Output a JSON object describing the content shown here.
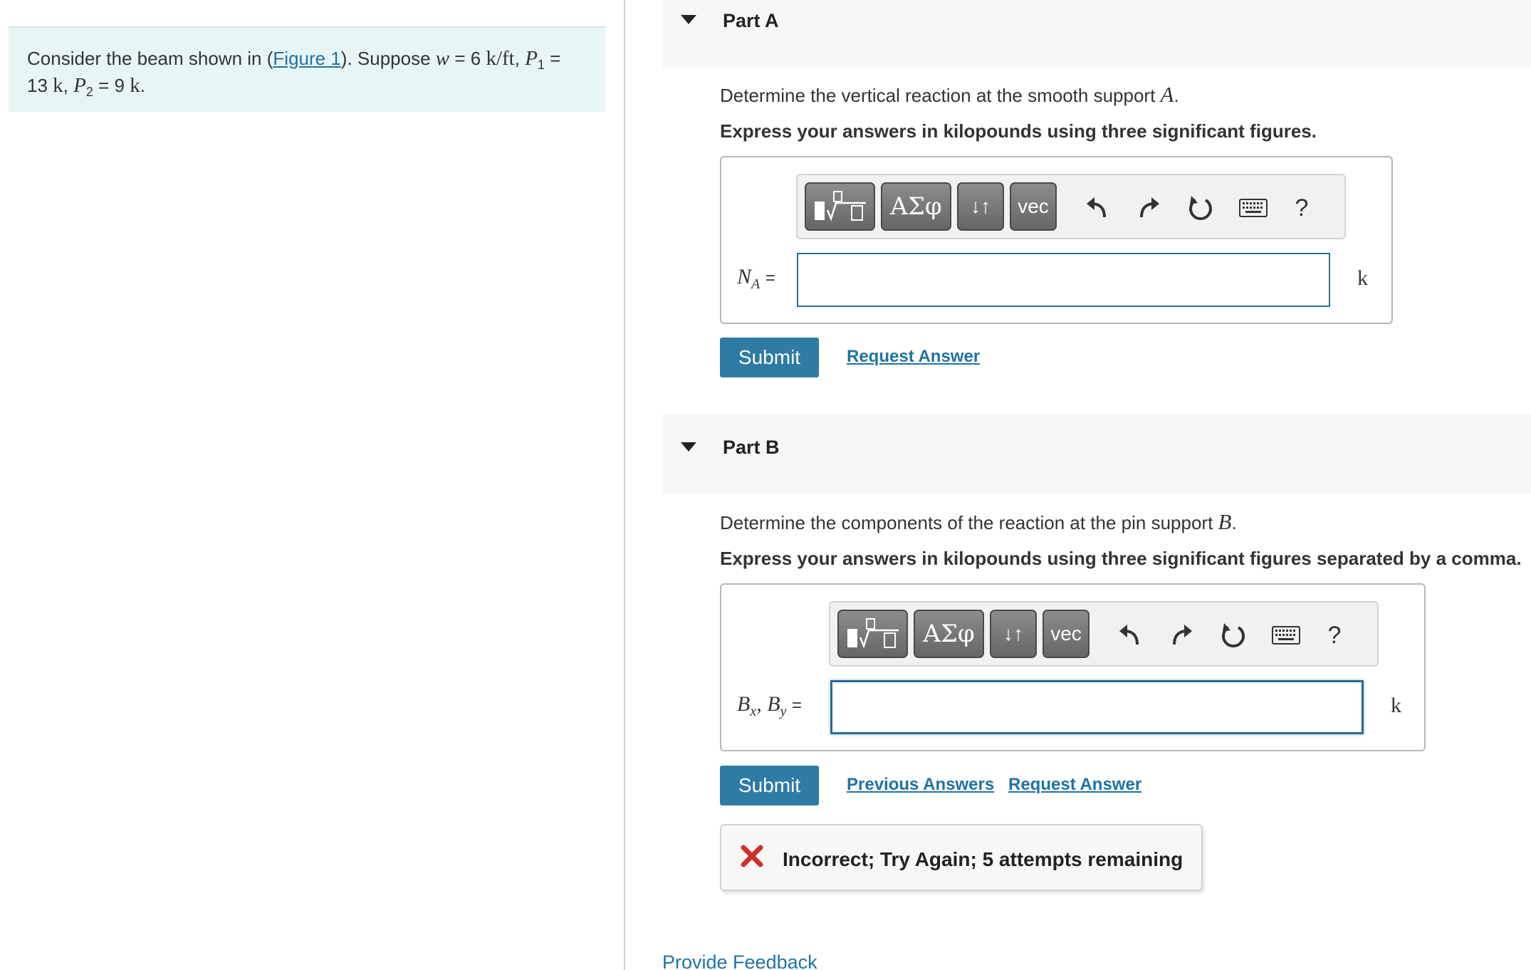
{
  "problem": {
    "text_before_link": "Consider the beam shown in (",
    "figure_link": "Figure 1",
    "text_after_link": "). Suppose ",
    "w_symbol": "w",
    "w_value": "6",
    "w_unit": "k/ft",
    "p1_symbol": "P",
    "p1_sub": "1",
    "p1_value": "13",
    "p1_unit": "k",
    "p2_symbol": "P",
    "p2_sub": "2",
    "p2_value": "9",
    "p2_unit": "k"
  },
  "toolbar": {
    "sqrt_label": "√",
    "greek_label": "ΑΣφ",
    "arrows_label": "↓↑",
    "vec_label": "vec",
    "help_label": "?"
  },
  "part_a": {
    "title": "Part A",
    "question_text": "Determine the vertical reaction at the smooth support ",
    "question_symbol": "A",
    "instruction": "Express your answers in kilopounds using three significant figures.",
    "label_var": "N",
    "label_sub": "A",
    "input_value": "",
    "unit": "k",
    "submit_label": "Submit",
    "request_answer_label": "Request Answer"
  },
  "part_b": {
    "title": "Part B",
    "question_text": "Determine the components of the reaction at the pin support ",
    "question_symbol": "B",
    "instruction": "Express your answers in kilopounds using three significant figures separated by a comma.",
    "label_var1": "B",
    "label_sub1": "x",
    "label_var2": "B",
    "label_sub2": "y",
    "input_value": "",
    "unit": "k",
    "submit_label": "Submit",
    "previous_answers_label": "Previous Answers",
    "request_answer_label": "Request Answer",
    "feedback_message": "Incorrect; Try Again; 5 attempts remaining"
  },
  "footer": {
    "provide_feedback_label": "Provide Feedback"
  },
  "colors": {
    "accent": "#2e7ba4",
    "link": "#2272a3",
    "problem_bg": "#e7f5f5",
    "error": "#d0312d"
  }
}
